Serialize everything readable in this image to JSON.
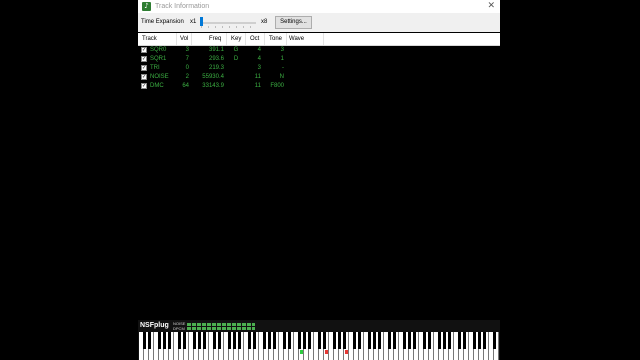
{
  "window": {
    "title": "Track Information",
    "close_glyph": "✕",
    "icon": "music-note-icon",
    "icon_glyph": "♪"
  },
  "toolbar": {
    "time_expansion_label": "Time Expansion",
    "min_label": "x1",
    "max_label": "x8",
    "settings_label": "Settings..."
  },
  "table": {
    "columns": [
      "Track",
      "Vol",
      "Freq",
      "Key",
      "Oct",
      "Tone",
      "Wave"
    ],
    "rows": [
      {
        "track": "SQR0",
        "vol": "3",
        "freq": "391.1",
        "key": "G",
        "oct": "4",
        "tone": "3",
        "wave": ""
      },
      {
        "track": "SQR1",
        "vol": "7",
        "freq": "293.6",
        "key": "D",
        "oct": "4",
        "tone": "1",
        "wave": ""
      },
      {
        "track": "TRI",
        "vol": "0",
        "freq": "219.3",
        "key": "",
        "oct": "3",
        "tone": "-",
        "wave": ""
      },
      {
        "track": "NOISE",
        "vol": "2",
        "freq": "55930.4",
        "key": "",
        "oct": "11",
        "tone": "N",
        "wave": ""
      },
      {
        "track": "DMC",
        "vol": "64",
        "freq": "33143.9",
        "key": "",
        "oct": "11",
        "tone": "F800",
        "wave": ""
      }
    ],
    "check_glyph": "✓"
  },
  "footer": {
    "brand": "NSFplug",
    "meters": [
      {
        "label": "NOISE"
      },
      {
        "label": "DPCM"
      }
    ]
  },
  "colors": {
    "text_green": "#3cb043",
    "note_green": "#2ecc40",
    "note_red": "#e53935",
    "accent": "#0078d7"
  }
}
